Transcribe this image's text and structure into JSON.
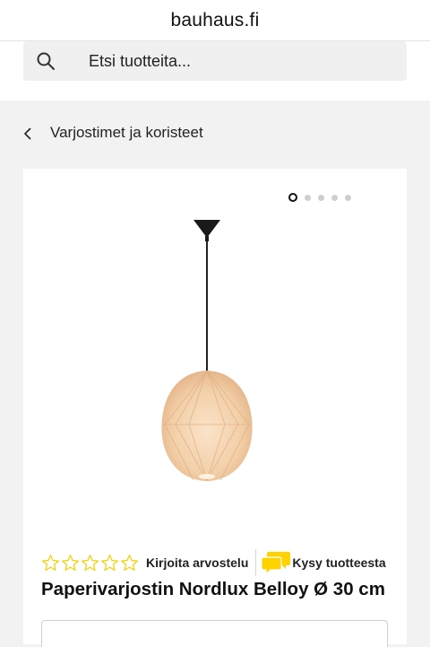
{
  "browser": {
    "url": "bauhaus.fi"
  },
  "search": {
    "placeholder": "Etsi tuotteita..."
  },
  "breadcrumb": {
    "label": "Varjostimet ja koristeet"
  },
  "gallery": {
    "image_count": 5,
    "active_index": 0
  },
  "product": {
    "title": "Paperivarjostin Nordlux Belloy Ø 30 cm",
    "rating": 0,
    "stars_max": 5,
    "write_review": "Kirjoita arvostelu",
    "ask_question": "Kysy tuotteesta"
  },
  "colors": {
    "star_yellow": "#f5d000",
    "ask_icon_yellow": "#ffd200"
  }
}
